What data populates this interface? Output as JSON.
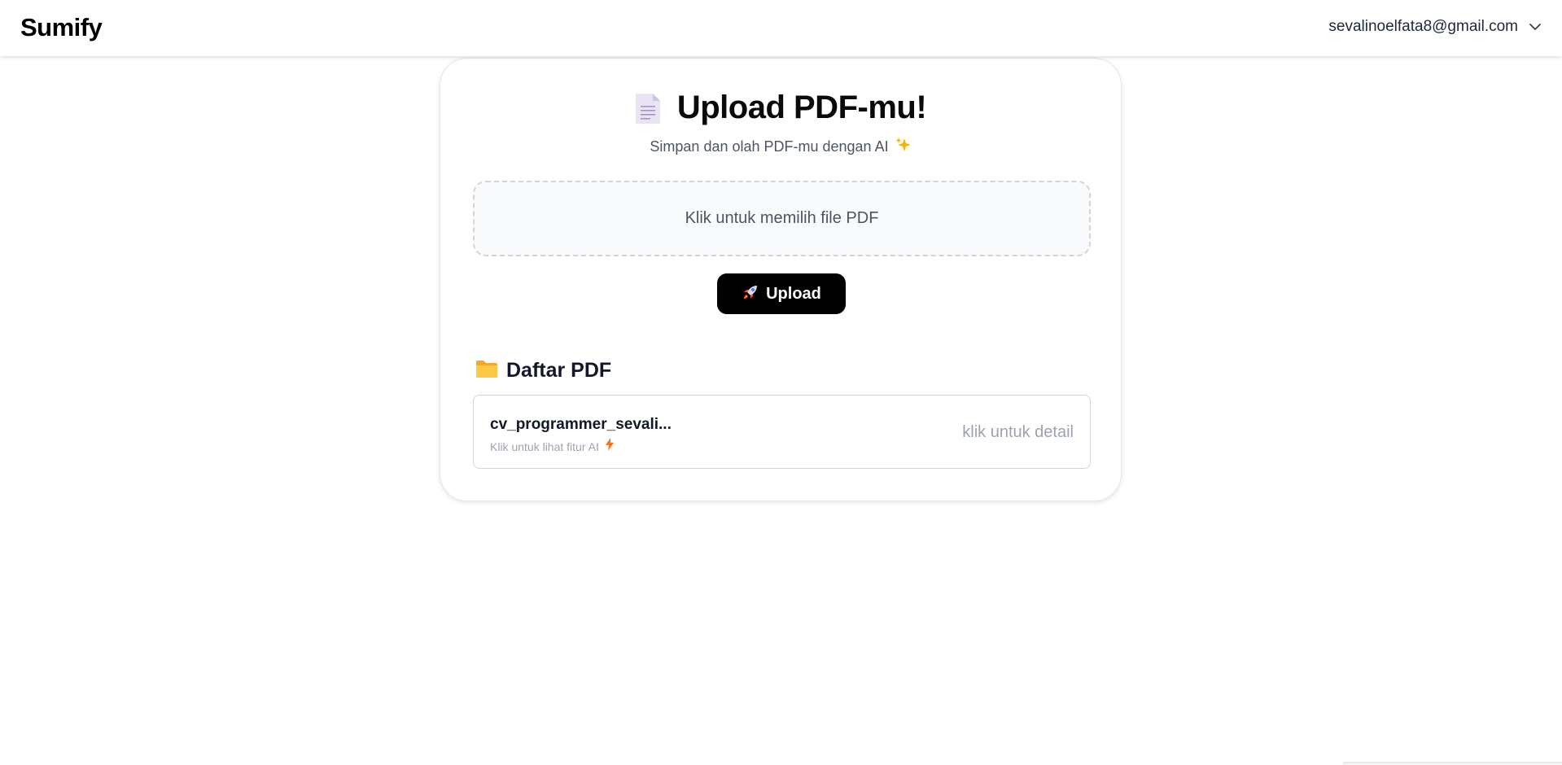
{
  "app": {
    "brand": "Sumify",
    "user_email": "sevalinoelfata8@gmail.com"
  },
  "upload": {
    "title": "Upload PDF-mu!",
    "subtitle": "Simpan dan olah PDF-mu dengan AI",
    "dropzone_text": "Klik untuk memilih file PDF",
    "button_label": "Upload"
  },
  "pdf_list": {
    "title": "Daftar PDF",
    "items": [
      {
        "name": "cv_programmer_sevali...",
        "hint": "Klik untuk lihat fitur AI",
        "detail_label": "klik untuk detail"
      }
    ]
  },
  "icons": {
    "title_icon": "document-icon",
    "subtitle_icon": "sparkles-icon",
    "button_icon": "rocket-icon",
    "list_icon": "folder-icon",
    "item_hint_icon": "lightning-icon",
    "user_menu_icon": "chevron-down-icon"
  },
  "colors": {
    "button_bg": "#000000",
    "card_border": "#e5e7eb",
    "dropzone_bg": "#f9fafb",
    "muted_text": "#9ca3af"
  }
}
